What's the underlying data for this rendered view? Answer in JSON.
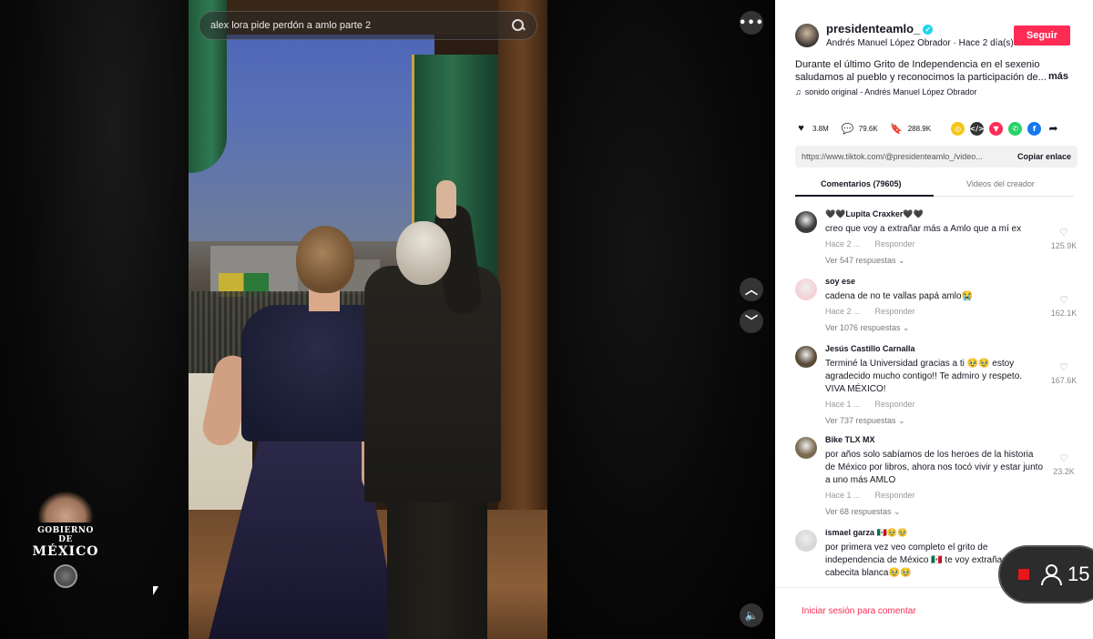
{
  "video": {
    "search_value": "alex lora pide perdón a amlo parte 2",
    "overlay_brand_line1": "GOBIERNO DE",
    "overlay_brand_line2": "MÉXICO",
    "more_symbol": "•••",
    "up_symbol": "︿",
    "down_symbol": "﹀",
    "volume_symbol": "🔈"
  },
  "author": {
    "username": "presidenteamlo_",
    "verified_symbol": "✓",
    "subtitle": "Andrés Manuel López Obrador · Hace 2 día(s)",
    "follow_label": "Seguir"
  },
  "post": {
    "description": "Durante el último Grito de Independencia en el sexenio saludamos al pueblo y reconocimos la participación de...",
    "more_label": "más",
    "music_icon": "♫",
    "music": "sonido original - Andrés Manuel López Obrador"
  },
  "actions": {
    "likes_icon": "♥",
    "likes": "3.8M",
    "comments_icon": "💬",
    "comments": "79.6K",
    "saves_icon": "🔖",
    "saves": "288.9K",
    "share_icons": [
      {
        "name": "friends",
        "symbol": "◎",
        "color": "#f5c518"
      },
      {
        "name": "embed",
        "symbol": "</>",
        "color": "#333333"
      },
      {
        "name": "send",
        "symbol": "▼",
        "color": "#fe2c55"
      },
      {
        "name": "whatsapp",
        "symbol": "✆",
        "color": "#25d366"
      },
      {
        "name": "facebook",
        "symbol": "f",
        "color": "#1877f2"
      },
      {
        "name": "share-arrow",
        "symbol": "➦",
        "color": "#161823"
      }
    ]
  },
  "link": {
    "url": "https://www.tiktok.com/@presidenteamlo_/video...",
    "copy_label": "Copiar enlace"
  },
  "tabs": {
    "comments": "Comentarios (79605)",
    "creator_videos": "Videos del creador"
  },
  "comments": [
    {
      "name": "🖤🖤Lupita Craxker🖤🖤",
      "text": "creo que voy a extrañar más a Amlo que a mí ex",
      "time": "Hace 2 ...",
      "reply": "Responder",
      "replies": "Ver 547 respuestas ⌄",
      "likes": "125.9K",
      "avatar_color": "#3a3a3a"
    },
    {
      "name": "soy ese",
      "text": "cadena de no te vallas papá amlo😭",
      "time": "Hace 2 ...",
      "reply": "Responder",
      "replies": "Ver 1076 respuestas ⌄",
      "likes": "162.1K",
      "avatar_color": "#f4d3d8"
    },
    {
      "name": "Jesús Castillo Carnalla",
      "text": "Terminé la Universidad gracias a ti 🥹🥹 estoy agradecido mucho contigo!! Te admiro y respeto. VIVA MÉXICO!",
      "time": "Hace 1 ...",
      "reply": "Responder",
      "replies": "Ver 737 respuestas ⌄",
      "likes": "167.6K",
      "avatar_color": "#5a4a38"
    },
    {
      "name": "Bike TLX MX",
      "text": "por años solo sabíamos de los heroes de la historia de México por libros, ahora nos tocó vivir y estar junto a uno más AMLO",
      "time": "Hace 1 ...",
      "reply": "Responder",
      "replies": "Ver 68 respuestas ⌄",
      "likes": "23.2K",
      "avatar_color": "#7a6a50"
    },
    {
      "name": "ismael garza 🇲🇽🥹🥹",
      "text": "por primera vez veo completo el grito de independencia de México 🇲🇽 te voy extrañar mi cabecita blanca🥹🥹",
      "time": "",
      "reply": "",
      "replies": "",
      "likes": "",
      "avatar_color": "#d8d8d8"
    }
  ],
  "login": {
    "label": "Iniciar sesión para comentar"
  },
  "live": {
    "viewers": "15"
  }
}
